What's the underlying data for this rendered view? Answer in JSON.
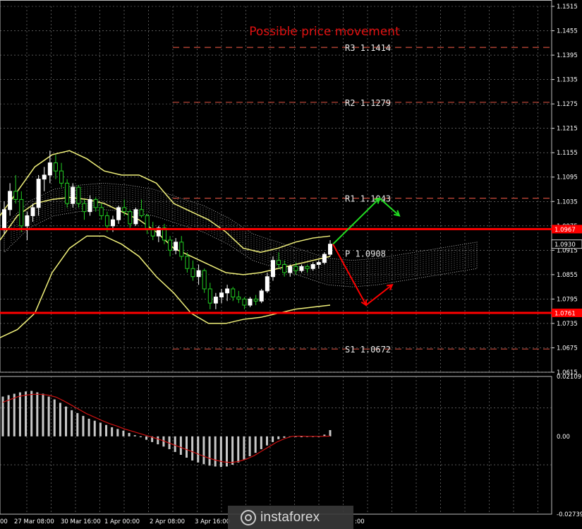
{
  "chart_data": [
    {
      "type": "candlestick",
      "title": "Possible price movement",
      "ylim": [
        1.0615,
        1.1515
      ],
      "y_ticks": [
        "1.1515",
        "1.1455",
        "1.1395",
        "1.1335",
        "1.1275",
        "1.1215",
        "1.1155",
        "1.1095",
        "1.1035",
        "1.0975",
        "1.0915",
        "1.0855",
        "1.0795",
        "1.0735",
        "1.0675",
        "1.0615"
      ],
      "x_ticks": [
        "00",
        "27 Mar 08:00",
        "30 Mar 16:00",
        "1 Apr 00:00",
        "2 Apr 08:00",
        "3 Apr 16:00",
        ":00"
      ],
      "price_marks": [
        {
          "label": "1.0967",
          "value": 1.0967,
          "color": "#ff0000"
        },
        {
          "label": "1.0930",
          "value": 1.093,
          "color": "#000000"
        },
        {
          "label": "1.0761",
          "value": 1.0761,
          "color": "#ff0000"
        }
      ],
      "levels": [
        {
          "name": "R3",
          "value": "1.1414"
        },
        {
          "name": "R2",
          "value": "1.1279"
        },
        {
          "name": "R1",
          "value": "1.1043"
        },
        {
          "name": "P",
          "value": "1.0908"
        },
        {
          "name": "S1",
          "value": "1.0672"
        }
      ],
      "horizontal_lines": [
        1.0967,
        1.0761
      ],
      "candles": [
        [
          1.0965,
          1.1035,
          1.0955,
          1.1015
        ],
        [
          1.1015,
          1.108,
          1.1,
          1.106
        ],
        [
          1.106,
          1.11,
          1.103,
          1.104
        ],
        [
          1.104,
          1.106,
          1.096,
          1.0975
        ],
        [
          1.0975,
          1.101,
          1.094,
          1.1
        ],
        [
          1.1,
          1.103,
          1.0985,
          1.102
        ],
        [
          1.102,
          1.11,
          1.1,
          1.109
        ],
        [
          1.109,
          1.112,
          1.106,
          1.11
        ],
        [
          1.11,
          1.116,
          1.108,
          1.113
        ],
        [
          1.113,
          1.115,
          1.109,
          1.111
        ],
        [
          1.111,
          1.113,
          1.107,
          1.108
        ],
        [
          1.108,
          1.109,
          1.102,
          1.103
        ],
        [
          1.103,
          1.108,
          1.102,
          1.107
        ],
        [
          1.107,
          1.1075,
          1.102,
          1.103
        ],
        [
          1.103,
          1.104,
          1.099,
          1.101
        ],
        [
          1.101,
          1.105,
          1.1,
          1.104
        ],
        [
          1.104,
          1.1045,
          1.101,
          1.102
        ],
        [
          1.102,
          1.103,
          1.099,
          1.1
        ],
        [
          1.1,
          1.101,
          1.096,
          1.0975
        ],
        [
          1.0975,
          1.1,
          1.096,
          1.099
        ],
        [
          1.099,
          1.1025,
          1.098,
          1.102
        ],
        [
          1.102,
          1.104,
          1.1,
          1.101
        ],
        [
          1.101,
          1.1015,
          1.097,
          1.098
        ],
        [
          1.098,
          1.102,
          1.0975,
          1.1015
        ],
        [
          1.1015,
          1.104,
          1.0995,
          1.1
        ],
        [
          1.1,
          1.1005,
          1.0955,
          1.0965
        ],
        [
          1.0965,
          1.0985,
          1.094,
          1.095
        ],
        [
          1.095,
          1.0975,
          1.0935,
          1.097
        ],
        [
          1.097,
          1.098,
          1.093,
          1.094
        ],
        [
          1.094,
          1.095,
          1.09,
          1.0915
        ],
        [
          1.0915,
          1.0945,
          1.0905,
          1.0935
        ],
        [
          1.0935,
          1.095,
          1.089,
          1.09
        ],
        [
          1.09,
          1.091,
          1.086,
          1.087
        ],
        [
          1.087,
          1.089,
          1.084,
          1.085
        ],
        [
          1.085,
          1.088,
          1.083,
          1.0865
        ],
        [
          1.0865,
          1.087,
          1.081,
          1.082
        ],
        [
          1.082,
          1.0835,
          1.077,
          1.0785
        ],
        [
          1.0785,
          1.081,
          1.077,
          1.08
        ],
        [
          1.08,
          1.082,
          1.0785,
          1.081
        ],
        [
          1.081,
          1.083,
          1.079,
          1.082
        ],
        [
          1.082,
          1.0825,
          1.079,
          1.08
        ],
        [
          1.08,
          1.0815,
          1.0785,
          1.0795
        ],
        [
          1.0795,
          1.08,
          1.077,
          1.078
        ],
        [
          1.078,
          1.08,
          1.0775,
          1.0795
        ],
        [
          1.0795,
          1.0805,
          1.078,
          1.079
        ],
        [
          1.079,
          1.082,
          1.0785,
          1.0815
        ],
        [
          1.0815,
          1.086,
          1.081,
          1.085
        ],
        [
          1.085,
          1.09,
          1.084,
          1.089
        ],
        [
          1.089,
          1.091,
          1.087,
          1.088
        ],
        [
          1.088,
          1.089,
          1.085,
          1.086
        ],
        [
          1.086,
          1.088,
          1.085,
          1.0875
        ],
        [
          1.0875,
          1.0885,
          1.0855,
          1.0865
        ],
        [
          1.0865,
          1.088,
          1.086,
          1.0875
        ],
        [
          1.0875,
          1.088,
          1.086,
          1.087
        ],
        [
          1.087,
          1.0885,
          1.0865,
          1.088
        ],
        [
          1.088,
          1.089,
          1.087,
          1.0885
        ],
        [
          1.0885,
          1.091,
          1.088,
          1.0905
        ],
        [
          1.0905,
          1.094,
          1.09,
          1.093
        ]
      ],
      "bollinger_upper": [
        1.1,
        1.106,
        1.112,
        1.115,
        1.116,
        1.114,
        1.111,
        1.11,
        1.11,
        1.108,
        1.103,
        1.101,
        1.099,
        1.096,
        1.092,
        1.091,
        1.092,
        1.0935,
        1.0945,
        1.095
      ],
      "bollinger_middle": [
        1.094,
        1.1,
        1.103,
        1.104,
        1.1045,
        1.104,
        1.103,
        1.101,
        1.099,
        1.096,
        1.092,
        1.09,
        1.088,
        1.086,
        1.0855,
        1.086,
        1.087,
        1.088,
        1.089,
        1.09
      ],
      "bollinger_lower": [
        1.07,
        1.072,
        1.076,
        1.086,
        1.092,
        1.095,
        1.095,
        1.093,
        1.09,
        1.085,
        1.081,
        1.076,
        1.0735,
        1.0735,
        1.0745,
        1.075,
        1.076,
        1.077,
        1.0775,
        1.078
      ],
      "forecast_up": [
        "1.0930",
        "1.1043",
        "1.1000"
      ],
      "forecast_down": [
        "1.0930",
        "1.0780",
        "1.0830"
      ]
    },
    {
      "type": "histogram",
      "ylim": [
        -0.02739,
        0.02109
      ],
      "y_ticks": [
        "0.02109",
        "0.00",
        "-0.02739"
      ],
      "values": [
        0.014,
        0.0145,
        0.015,
        0.0155,
        0.0158,
        0.016,
        0.0155,
        0.015,
        0.014,
        0.013,
        0.0118,
        0.0105,
        0.0092,
        0.0082,
        0.0072,
        0.0062,
        0.0055,
        0.0048,
        0.004,
        0.0032,
        0.0026,
        0.002,
        0.0012,
        0.0004,
        -0.0003,
        -0.0012,
        -0.002,
        -0.0028,
        -0.0036,
        -0.0045,
        -0.0055,
        -0.0065,
        -0.0075,
        -0.0085,
        -0.0092,
        -0.0098,
        -0.0103,
        -0.0106,
        -0.0108,
        -0.0106,
        -0.01,
        -0.0092,
        -0.0082,
        -0.007,
        -0.0058,
        -0.0045,
        -0.0032,
        -0.002,
        -0.001,
        -0.0005,
        -0.0002,
        -0.0002,
        -0.0003,
        -0.0002,
        -0.0001,
        0.0,
        0.0006,
        0.0022
      ],
      "signal": [
        0.012,
        0.013,
        0.014,
        0.0145,
        0.0148,
        0.0148,
        0.0145,
        0.0138,
        0.0125,
        0.011,
        0.0095,
        0.008,
        0.0068,
        0.0056,
        0.0045,
        0.0036,
        0.0026,
        0.0018,
        0.001,
        0.0002,
        -0.0006,
        -0.0015,
        -0.0025,
        -0.0035,
        -0.0045,
        -0.0055,
        -0.0066,
        -0.0076,
        -0.0084,
        -0.009,
        -0.0092,
        -0.0088,
        -0.008,
        -0.0068,
        -0.0052,
        -0.0036,
        -0.002,
        -0.0008,
        0.0,
        0.0001,
        0.0,
        0.0,
        0.0,
        0.0001
      ]
    }
  ],
  "watermark": {
    "text": "instaforex"
  },
  "colors": {
    "bg": "#000000",
    "grid": "#8a8a8a",
    "bull": "#ffffff",
    "bear": "#22cc22",
    "boll": "#f0f07a",
    "red": "#ff0000",
    "green": "#22dd22",
    "macd": "#c8c8c8",
    "signal": "#cc1111",
    "title": "#e01010"
  }
}
